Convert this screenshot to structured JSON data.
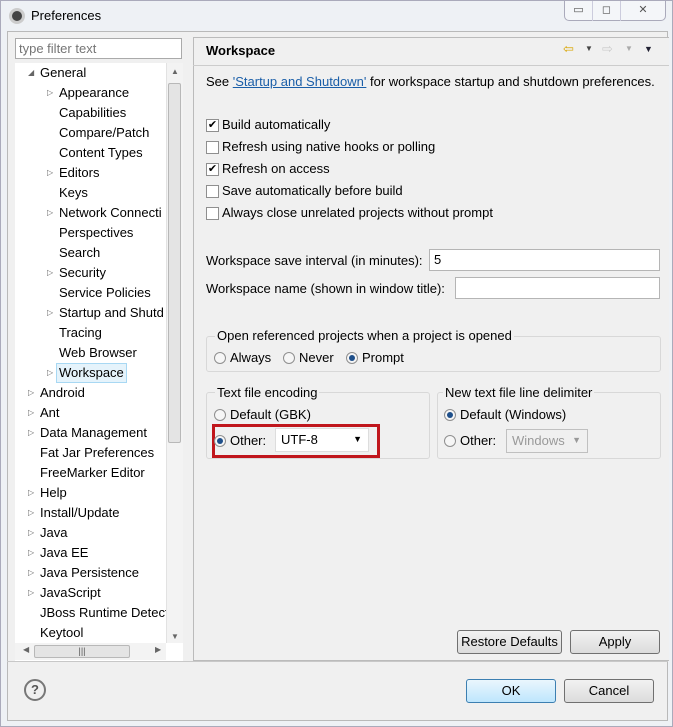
{
  "window": {
    "title": "Preferences",
    "minimize": "▭",
    "maximize": "◻",
    "close": "✕"
  },
  "filter": {
    "placeholder": "type filter text"
  },
  "tree": [
    {
      "label": "General",
      "level": 0,
      "arrow": "◢"
    },
    {
      "label": "Appearance",
      "level": 1,
      "arrow": "▷"
    },
    {
      "label": "Capabilities",
      "level": 1,
      "arrow": ""
    },
    {
      "label": "Compare/Patch",
      "level": 1,
      "arrow": ""
    },
    {
      "label": "Content Types",
      "level": 1,
      "arrow": ""
    },
    {
      "label": "Editors",
      "level": 1,
      "arrow": "▷"
    },
    {
      "label": "Keys",
      "level": 1,
      "arrow": ""
    },
    {
      "label": "Network Connecti",
      "level": 1,
      "arrow": "▷"
    },
    {
      "label": "Perspectives",
      "level": 1,
      "arrow": ""
    },
    {
      "label": "Search",
      "level": 1,
      "arrow": ""
    },
    {
      "label": "Security",
      "level": 1,
      "arrow": "▷"
    },
    {
      "label": "Service Policies",
      "level": 1,
      "arrow": ""
    },
    {
      "label": "Startup and Shutd",
      "level": 1,
      "arrow": "▷"
    },
    {
      "label": "Tracing",
      "level": 1,
      "arrow": ""
    },
    {
      "label": "Web Browser",
      "level": 1,
      "arrow": ""
    },
    {
      "label": "Workspace",
      "level": 1,
      "arrow": "▷",
      "selected": true
    },
    {
      "label": "Android",
      "level": 0,
      "arrow": "▷"
    },
    {
      "label": "Ant",
      "level": 0,
      "arrow": "▷"
    },
    {
      "label": "Data Management",
      "level": 0,
      "arrow": "▷"
    },
    {
      "label": "Fat Jar Preferences",
      "level": 0,
      "arrow": ""
    },
    {
      "label": "FreeMarker Editor",
      "level": 0,
      "arrow": ""
    },
    {
      "label": "Help",
      "level": 0,
      "arrow": "▷"
    },
    {
      "label": "Install/Update",
      "level": 0,
      "arrow": "▷"
    },
    {
      "label": "Java",
      "level": 0,
      "arrow": "▷"
    },
    {
      "label": "Java EE",
      "level": 0,
      "arrow": "▷"
    },
    {
      "label": "Java Persistence",
      "level": 0,
      "arrow": "▷"
    },
    {
      "label": "JavaScript",
      "level": 0,
      "arrow": "▷"
    },
    {
      "label": "JBoss Runtime Detect",
      "level": 0,
      "arrow": ""
    },
    {
      "label": "Keytool",
      "level": 0,
      "arrow": ""
    }
  ],
  "page": {
    "title": "Workspace",
    "desc_prefix": "See ",
    "desc_link": "'Startup and Shutdown'",
    "desc_suffix": " for workspace startup and shutdown preferences.",
    "checkboxes": [
      {
        "label": "Build automatically",
        "checked": true
      },
      {
        "label": "Refresh using native hooks or polling",
        "checked": false
      },
      {
        "label": "Refresh on access",
        "checked": true
      },
      {
        "label": "Save automatically before build",
        "checked": false
      },
      {
        "label": "Always close unrelated projects without prompt",
        "checked": false
      }
    ],
    "save_interval_label": "Workspace save interval (in minutes):",
    "save_interval_value": "5",
    "ws_name_label": "Workspace name (shown in window title):",
    "ws_name_value": "",
    "open_ref": {
      "label": "Open referenced projects when a project is opened",
      "options": [
        "Always",
        "Never",
        "Prompt"
      ],
      "selected": "Prompt"
    },
    "encoding": {
      "label": "Text file encoding",
      "default": "Default (GBK)",
      "other": "Other:",
      "value": "UTF-8",
      "selected": "Other"
    },
    "delimiter": {
      "label": "New text file line delimiter",
      "default": "Default (Windows)",
      "other": "Other:",
      "value": "Windows",
      "selected": "Default"
    },
    "restore_defaults": "Restore Defaults",
    "apply": "Apply"
  },
  "footer": {
    "help": "?",
    "ok": "OK",
    "cancel": "Cancel"
  },
  "colors": {
    "highlight": "#c0161c",
    "link": "#1a5ea8"
  }
}
